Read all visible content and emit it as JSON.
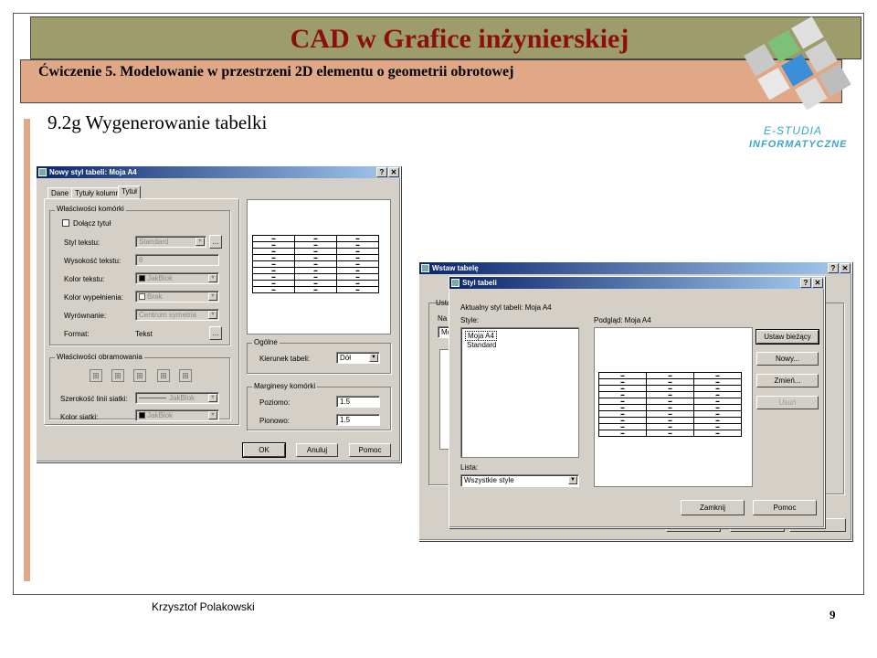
{
  "slide": {
    "title": "CAD w Grafice inżynierskiej",
    "subtitle": "Ćwiczenie 5. Modelowanie w przestrzeni 2D elementu o geometrii obrotowej",
    "section": "9.2g Wygenerowanie tabelki",
    "author": "Krzysztof Polakowski",
    "page": "9",
    "logo_line1": "E-STUDIA",
    "logo_line2": "INFORMATYCZNE"
  },
  "colors": {
    "title_band": "#9c9d6b",
    "sub_band": "#e0a886",
    "title_text": "#8b0f0f",
    "logo": "#3ba4c9",
    "titlebar": "#0a246a"
  },
  "dialog1": {
    "title": "Nowy styl tabeli: Moja A4",
    "help_btn": "?",
    "close_btn": "✕",
    "tabs": [
      "Dane",
      "Tytuły kolumn",
      "Tytuł"
    ],
    "cell_props_group": "Właściwości komórki",
    "include_title": "Dołącz tytuł",
    "text_style_label": "Styl tekstu:",
    "text_style_value": "Standard",
    "text_height_label": "Wysokość tekstu:",
    "text_height_value": "6",
    "text_color_label": "Kolor tekstu:",
    "text_color_value": "JakBlok",
    "fill_color_label": "Kolor wypełnienia:",
    "fill_color_value": "Brak",
    "align_label": "Wyrównanie:",
    "align_value": "Centrum symetria",
    "format_label": "Format:",
    "format_value": "Tekst",
    "border_props_group": "Właściwości obramowania",
    "grid_lineweight_label": "Szerokość linii siatki:",
    "grid_lineweight_value": "JakBlok",
    "grid_color_label": "Kolor siatki:",
    "grid_color_value": "JakBlok",
    "general_group": "Ogólne",
    "table_direction_label": "Kierunek tabeli:",
    "table_direction_value": "Dół",
    "margins_group": "Marginesy komórki",
    "horizontal_label": "Poziomo:",
    "horizontal_value": "1.5",
    "vertical_label": "Pionowo:",
    "vertical_value": "1.5",
    "ok": "OK",
    "cancel": "Anuluj",
    "help": "Pomoc",
    "ellipsis": "..."
  },
  "dialog2": {
    "title": "Wstaw tabelę",
    "help_btn": "?",
    "close_btn": "✕",
    "partial_label": "Usta",
    "partial_label2": "Na",
    "partial_field": "Mo"
  },
  "dialog3": {
    "title": "Styl tabeli",
    "help_btn": "?",
    "close_btn": "✕",
    "current_style": "Aktualny styl tabeli: Moja A4",
    "styles_label": "Style:",
    "styles": [
      "Moja A4",
      "Standard"
    ],
    "preview_label": "Podgląd: Moja A4",
    "set_current": "Ustaw bieżący",
    "new": "Nowy...",
    "modify": "Zmień...",
    "delete": "Usuń",
    "list_label": "Lista:",
    "list_value": "Wszystkie style",
    "close": "Zamknij",
    "help": "Pomoc"
  }
}
